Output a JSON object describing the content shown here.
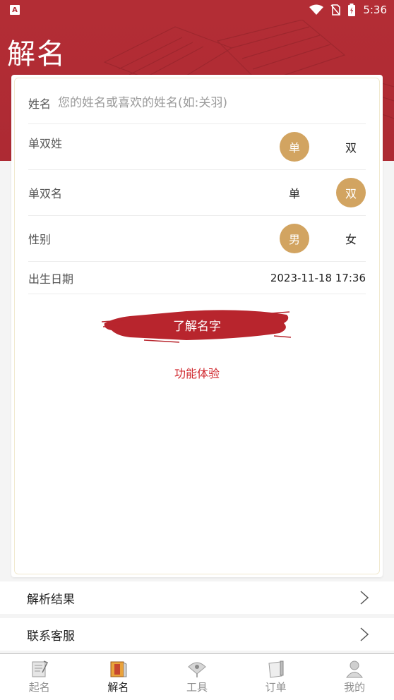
{
  "status_bar": {
    "app_badge": "A",
    "time": "5:36"
  },
  "header": {
    "title": "解名"
  },
  "form": {
    "name_label": "姓名",
    "name_placeholder": "您的姓名或喜欢的姓名(如:关羽)",
    "name_value": "",
    "surname_type": {
      "label": "单双姓",
      "options": [
        "单",
        "双"
      ],
      "selected": "单"
    },
    "given_name_type": {
      "label": "单双名",
      "options": [
        "单",
        "双"
      ],
      "selected": "双"
    },
    "gender": {
      "label": "性别",
      "options": [
        "男",
        "女"
      ],
      "selected": "男"
    },
    "birth_date": {
      "label": "出生日期",
      "value": "2023-11-18 17:36"
    },
    "submit_label": "了解名字",
    "trial_link": "功能体验"
  },
  "list": {
    "items": [
      {
        "label": "解析结果"
      },
      {
        "label": "联系客服"
      }
    ]
  },
  "tabbar": {
    "tabs": [
      {
        "label": "起名",
        "icon": "naming-book-icon",
        "active": false
      },
      {
        "label": "解名",
        "icon": "scroll-book-icon",
        "active": true
      },
      {
        "label": "工具",
        "icon": "fan-tool-icon",
        "active": false
      },
      {
        "label": "订单",
        "icon": "order-paper-icon",
        "active": false
      },
      {
        "label": "我的",
        "icon": "profile-figure-icon",
        "active": false
      }
    ]
  },
  "colors": {
    "brand_red": "#b32d35",
    "selected_gold": "#d2a461",
    "link_red": "#d0282e"
  }
}
